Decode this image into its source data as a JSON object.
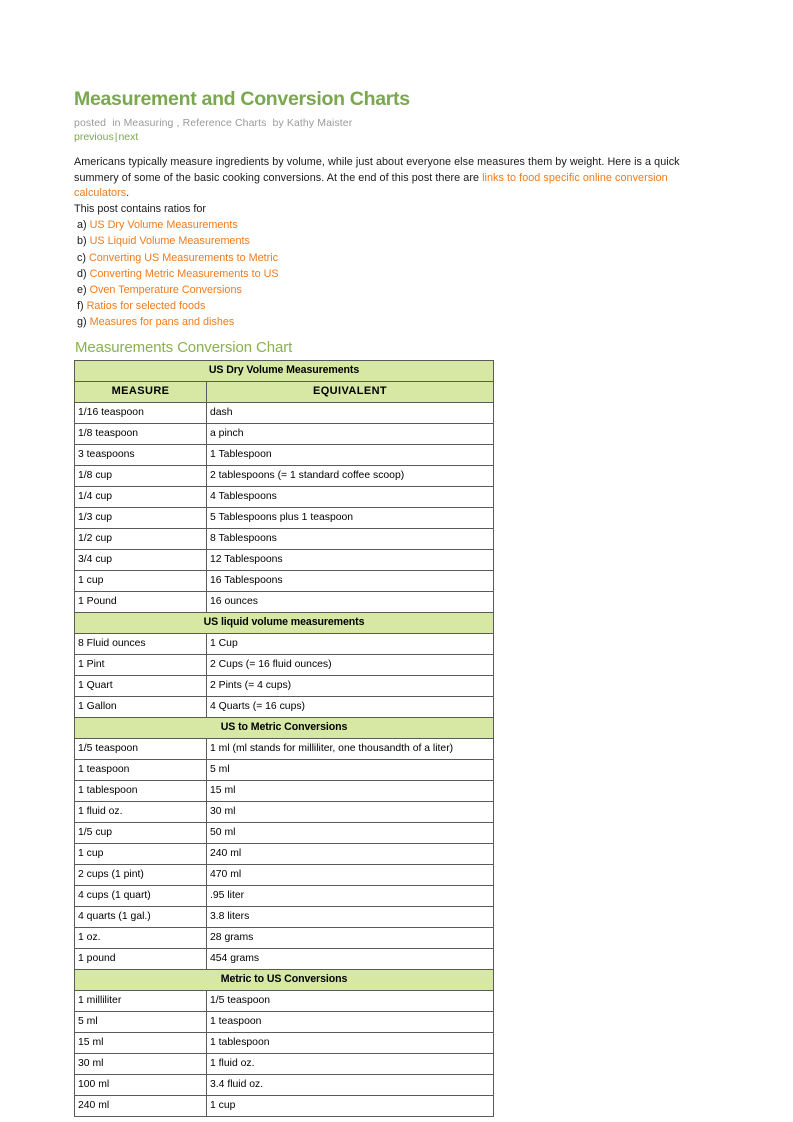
{
  "post": {
    "title": "Measurement and Conversion Charts",
    "byline": {
      "posted": "posted",
      "in": "in Measuring",
      "comma": ",",
      "category": "Reference Charts",
      "author": "by Kathy Maister"
    },
    "nav": {
      "previous": "previous",
      "divider": "|",
      "next": "next"
    },
    "intro_part1": "Americans typically measure ingredients by volume, while just about everyone else measures them by weight. Here is a quick summery of some of the basic cooking conversions. At the end of this post there are ",
    "intro_link": "links to food specific online conversion calculators",
    "intro_part2": ".",
    "contains_label": "This post contains ratios for",
    "toc": [
      {
        "marker": "a)",
        "label": "US Dry Volume Measurements"
      },
      {
        "marker": "b)",
        "label": "US Liquid Volume Measurements"
      },
      {
        "marker": "c)",
        "label": "Converting US Measurements to Metric"
      },
      {
        "marker": "d)",
        "label": "Converting Metric Measurements to US"
      },
      {
        "marker": "e)",
        "label": "Oven Temperature Conversions"
      },
      {
        "marker": "f)",
        "label": "Ratios for selected foods"
      },
      {
        "marker": "g)",
        "label": "Measures for pans and dishes"
      }
    ]
  },
  "chart": {
    "heading": "Measurements Conversion Chart",
    "column_headers": {
      "measure": "MEASURE",
      "equivalent": "EQUIVALENT"
    },
    "sections": [
      {
        "title": "US Dry Volume Measurements",
        "has_column_header": true,
        "rows": [
          [
            "1/16 teaspoon",
            "dash"
          ],
          [
            "1/8 teaspoon",
            "a pinch"
          ],
          [
            "3 teaspoons",
            "1 Tablespoon"
          ],
          [
            "1/8 cup",
            "2 tablespoons (= 1 standard coffee scoop)"
          ],
          [
            "1/4 cup",
            "4 Tablespoons"
          ],
          [
            "1/3 cup",
            "5 Tablespoons plus 1 teaspoon"
          ],
          [
            "1/2 cup",
            "8 Tablespoons"
          ],
          [
            "3/4 cup",
            "12 Tablespoons"
          ],
          [
            "1 cup",
            "16 Tablespoons"
          ],
          [
            "1 Pound",
            "16 ounces"
          ]
        ]
      },
      {
        "title": "US liquid volume measurements",
        "has_column_header": false,
        "rows": [
          [
            "8 Fluid ounces",
            "1 Cup"
          ],
          [
            "1 Pint",
            "2 Cups (= 16 fluid ounces)"
          ],
          [
            "1 Quart",
            "2 Pints (= 4 cups)"
          ],
          [
            "1 Gallon",
            "4 Quarts (= 16 cups)"
          ]
        ]
      },
      {
        "title": "US to Metric Conversions",
        "has_column_header": false,
        "rows": [
          [
            "1/5 teaspoon",
            "1 ml (ml stands for milliliter, one thousandth of  a liter)"
          ],
          [
            "1 teaspoon",
            "5 ml"
          ],
          [
            "1 tablespoon",
            "15 ml"
          ],
          [
            "1 fluid oz.",
            "30 ml"
          ],
          [
            "1/5 cup",
            "50 ml"
          ],
          [
            "1 cup",
            "240 ml"
          ],
          [
            "2 cups (1 pint)",
            "470 ml"
          ],
          [
            "4 cups (1 quart)",
            ".95 liter"
          ],
          [
            "4 quarts (1 gal.)",
            "3.8 liters"
          ],
          [
            "1 oz.",
            "28 grams"
          ],
          [
            "1 pound",
            "454 grams"
          ]
        ]
      },
      {
        "title": "Metric to US Conversions",
        "has_column_header": false,
        "rows": [
          [
            "1 milliliter",
            "1/5 teaspoon"
          ],
          [
            "5 ml",
            "1 teaspoon"
          ],
          [
            "15 ml",
            "1 tablespoon"
          ],
          [
            "30 ml",
            "1 fluid oz."
          ],
          [
            "100 ml",
            "3.4 fluid oz."
          ],
          [
            "240 ml",
            "1 cup"
          ]
        ]
      }
    ]
  },
  "colors": {
    "title_green": "#7aa84f",
    "heading_green": "#8ab04f",
    "link_orange": "#ee7b1e",
    "table_header_green": "#d7e8a4",
    "byline_gray": "#9a9a9a"
  }
}
